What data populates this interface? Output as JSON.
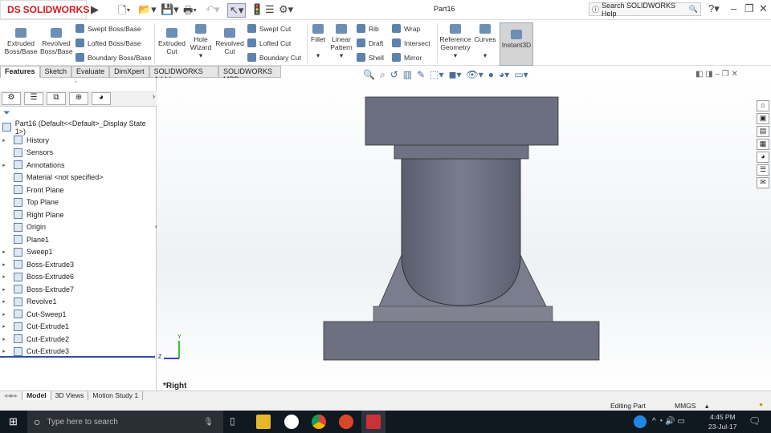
{
  "app": {
    "logo": "SOLIDWORKS",
    "title": "Part16",
    "search_placeholder": "Search SOLIDWORKS Help"
  },
  "ribbon": {
    "big": [
      "Extruded Boss/Base",
      "Revolved Boss/Base",
      "Extruded Cut",
      "Hole Wizard",
      "Revolved Cut",
      "Fillet",
      "Linear Pattern",
      "Reference Geometry",
      "Curves",
      "Instant3D"
    ],
    "small": [
      "Swept Boss/Base",
      "Lofted Boss/Base",
      "Boundary Boss/Base",
      "Swept Cut",
      "Lofted Cut",
      "Boundary Cut",
      "Rib",
      "Draft",
      "Shell",
      "Wrap",
      "Intersect",
      "Mirror"
    ]
  },
  "tabs": [
    "Features",
    "Sketch",
    "Evaluate",
    "DimXpert",
    "SOLIDWORKS Add-Ins",
    "SOLIDWORKS MBD"
  ],
  "tree": {
    "root": "Part16  (Default<<Default>_Display State 1>)",
    "items": [
      "History",
      "Sensors",
      "Annotations",
      "Material <not specified>",
      "Front Plane",
      "Top Plane",
      "Right Plane",
      "Origin",
      "Plane1",
      "Sweep1",
      "Boss-Extrude3",
      "Boss-Extrude6",
      "Boss-Extrude7",
      "Revolve1",
      "Cut-Sweep1",
      "Cut-Extrude1",
      "Cut-Extrude2",
      "Cut-Extrude3"
    ]
  },
  "viewport": {
    "view_label": "*Right",
    "axis_y": "Y",
    "axis_z": "Z"
  },
  "bottom_tabs": [
    "Model",
    "3D Views",
    "Motion Study 1"
  ],
  "status": {
    "mode": "Editing Part",
    "units": "MMGS"
  },
  "taskbar": {
    "search": "Type here to search",
    "time": "4:45 PM",
    "date": "23-Jul-17"
  }
}
